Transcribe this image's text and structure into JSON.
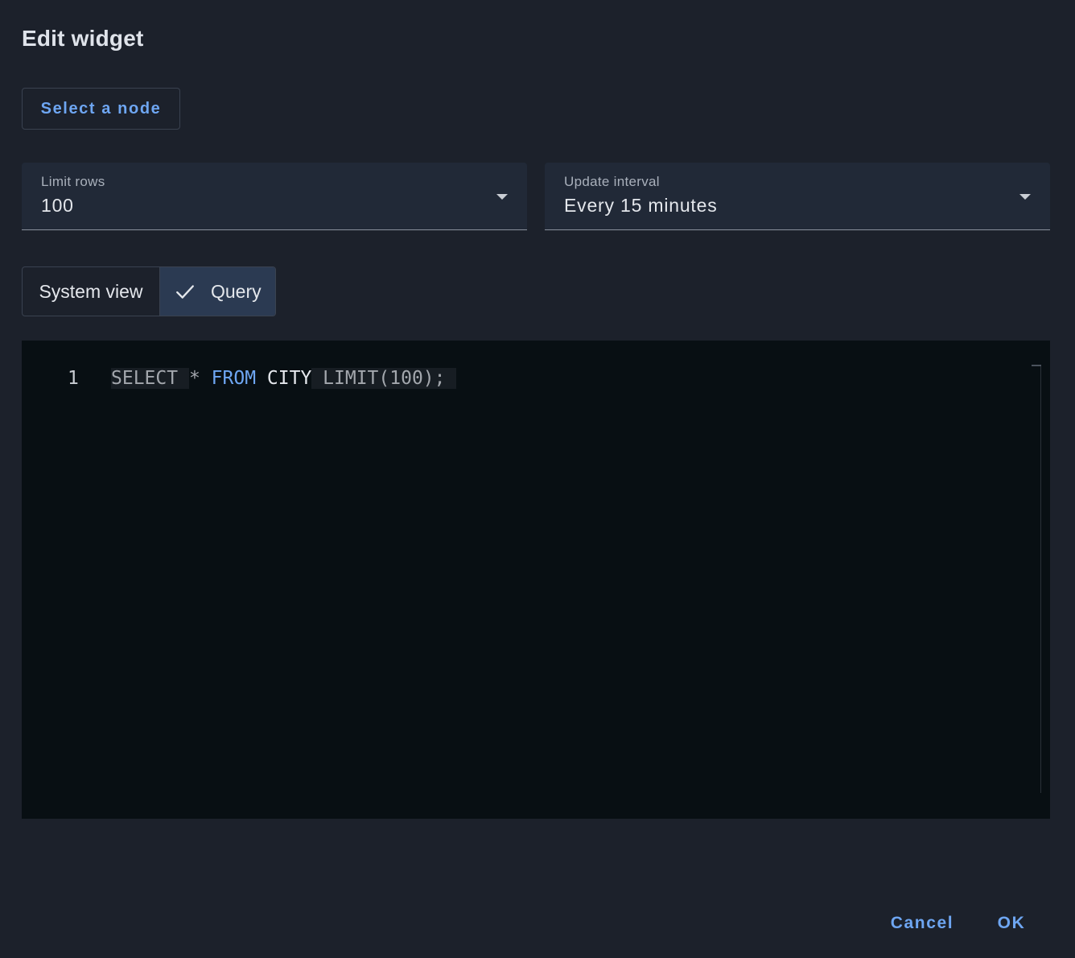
{
  "dialog": {
    "title": "Edit widget",
    "select_node_label": "Select a node"
  },
  "limit_rows": {
    "label": "Limit rows",
    "value": "100"
  },
  "update_interval": {
    "label": "Update interval",
    "value": "Every 15 minutes"
  },
  "mode_toggle": {
    "system_view_label": "System view",
    "query_label": "Query",
    "selected": "Query"
  },
  "editor": {
    "line_number": "1",
    "tokens": {
      "select": "SELECT",
      "star": "*",
      "from": "FROM",
      "table": "CITY",
      "limit": "LIMIT(100);"
    }
  },
  "actions": {
    "cancel_label": "Cancel",
    "ok_label": "OK"
  },
  "colors": {
    "background": "#1c212b",
    "accent": "#6ea6f2",
    "editor_bg": "#080f13"
  },
  "icons": {
    "query_selected": "check-icon",
    "select_arrow": "dropdown-arrow-icon"
  }
}
